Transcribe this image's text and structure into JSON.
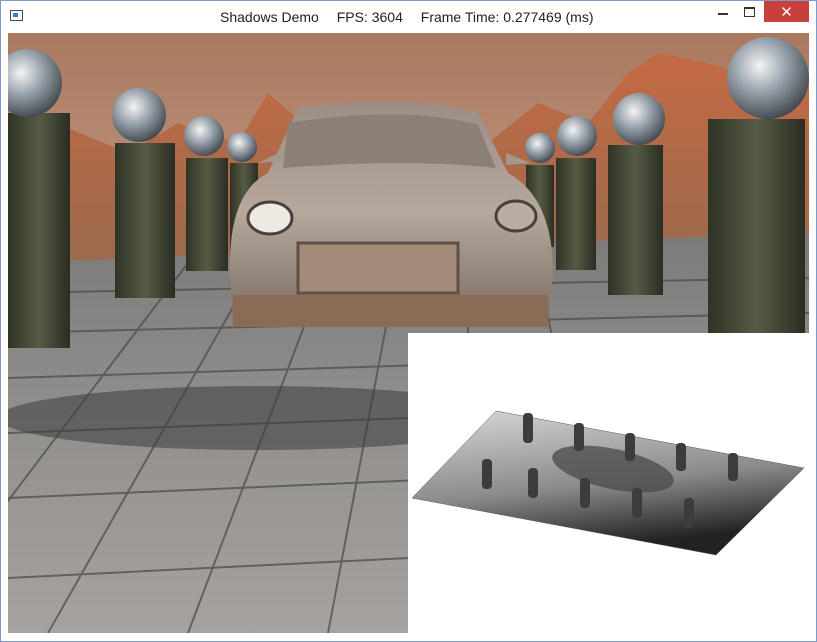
{
  "window": {
    "title": "Shadows Demo",
    "fps_label": "FPS: 3604",
    "frame_time_label": "Frame Time: 0.277469 (ms)",
    "minimize_icon": "minimize-icon",
    "maximize_icon": "maximize-icon",
    "close_glyph": "✕"
  },
  "colors": {
    "sky": "#a9795f",
    "floor": "#8e8c8a",
    "close_button": "#c7403a",
    "window_border": "#7a9ccc"
  },
  "scene": {
    "objects": [
      "desert-mountains",
      "tiled-floor",
      "stone-pillars",
      "chrome-spheres",
      "car-model"
    ]
  },
  "shadow_map": {
    "description_icon": "shadow-map-icon"
  }
}
